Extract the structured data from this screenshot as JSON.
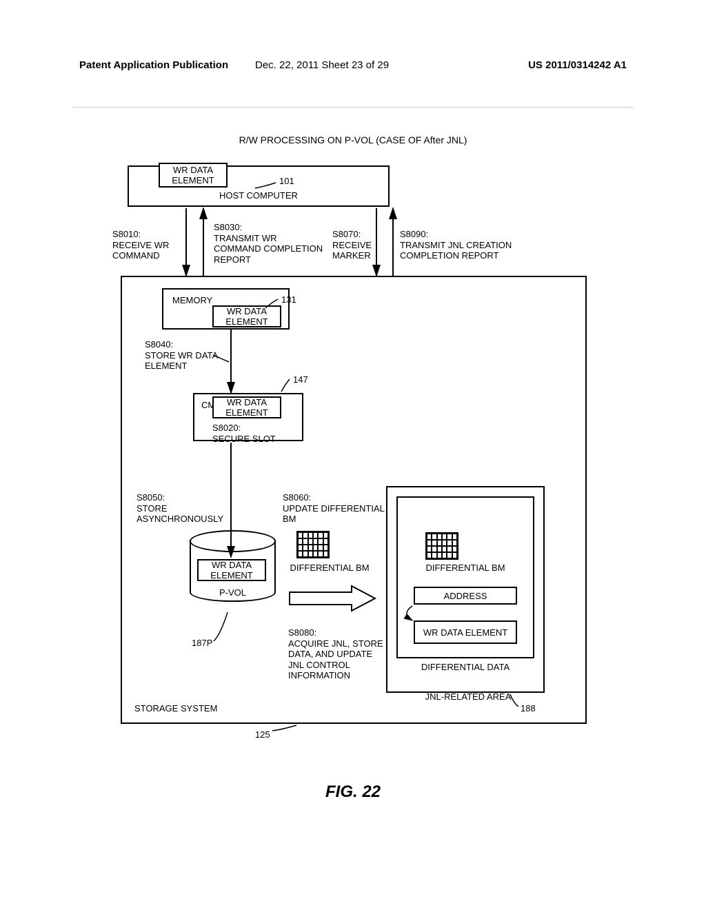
{
  "header": {
    "left": "Patent Application Publication",
    "mid": "Dec. 22, 2011  Sheet 23 of 29",
    "right": "US 2011/0314242 A1"
  },
  "title": "R/W PROCESSING ON P-VOL (CASE OF After JNL)",
  "fig": "FIG. 22",
  "host": {
    "label": "HOST COMPUTER",
    "wrdata": "WR DATA ELEMENT",
    "ref": "101"
  },
  "steps": {
    "s8010": "S8010:\nRECEIVE WR COMMAND",
    "s8030": "S8030:\nTRANSMIT WR COMMAND COMPLETION REPORT",
    "s8070": "S8070:\nRECEIVE MARKER",
    "s8090": "S8090:\nTRANSMIT JNL CREATION COMPLETION REPORT",
    "s8040": "S8040:\nSTORE WR DATA ELEMENT",
    "s8020": "S8020:\nSECURE SLOT",
    "s8050": "S8050:\nSTORE ASYNCHRONOUSLY",
    "s8060": "S8060:\nUPDATE DIFFERENTIAL BM",
    "s8080": "S8080:\nACQUIRE JNL, STORE DATA, AND UPDATE JNL CONTROL INFORMATION"
  },
  "storage": {
    "label": "STORAGE SYSTEM",
    "ref": "125"
  },
  "memory": {
    "label": "MEMORY",
    "wrdata": "WR DATA ELEMENT",
    "ref": "131"
  },
  "cm": {
    "label": "CM",
    "wrdata": "WR DATA ELEMENT",
    "ref": "147"
  },
  "pvol": {
    "wrdata": "WR DATA ELEMENT",
    "label": "P-VOL",
    "ref": "187P"
  },
  "diffbm": {
    "left": "DIFFERENTIAL BM",
    "right": "DIFFERENTIAL BM"
  },
  "jnl": {
    "address": "ADDRESS",
    "wrdata": "WR DATA ELEMENT",
    "diffdata": "DIFFERENTIAL DATA",
    "label": "JNL-RELATED AREA",
    "ref": "188"
  },
  "chart_data": {
    "type": "diagram",
    "title": "R/W PROCESSING ON P-VOL (CASE OF After JNL)",
    "figure": "FIG. 22",
    "nodes": [
      {
        "id": "host",
        "ref": 101,
        "label": "HOST COMPUTER",
        "contains": [
          "WR DATA ELEMENT"
        ]
      },
      {
        "id": "storage",
        "ref": 125,
        "label": "STORAGE SYSTEM"
      },
      {
        "id": "memory",
        "ref": 131,
        "label": "MEMORY",
        "parent": "storage",
        "contains": [
          "WR DATA ELEMENT"
        ]
      },
      {
        "id": "cm",
        "ref": 147,
        "label": "CM",
        "parent": "storage",
        "contains": [
          "WR DATA ELEMENT"
        ]
      },
      {
        "id": "pvol",
        "ref": "187P",
        "label": "P-VOL",
        "parent": "storage",
        "contains": [
          "WR DATA ELEMENT"
        ]
      },
      {
        "id": "diffbm_left",
        "label": "DIFFERENTIAL BM",
        "parent": "storage"
      },
      {
        "id": "jnl_area",
        "ref": 188,
        "label": "JNL-RELATED AREA",
        "parent": "storage"
      },
      {
        "id": "diff_data",
        "label": "DIFFERENTIAL DATA",
        "parent": "jnl_area",
        "contains": [
          "DIFFERENTIAL BM",
          "ADDRESS",
          "WR DATA ELEMENT"
        ]
      }
    ],
    "steps": [
      {
        "id": "S8010",
        "text": "RECEIVE WR COMMAND",
        "from": "host",
        "to": "storage"
      },
      {
        "id": "S8020",
        "text": "SECURE SLOT",
        "at": "cm"
      },
      {
        "id": "S8030",
        "text": "TRANSMIT WR COMMAND COMPLETION REPORT",
        "from": "storage",
        "to": "host"
      },
      {
        "id": "S8040",
        "text": "STORE WR DATA ELEMENT",
        "from": "memory",
        "to": "cm"
      },
      {
        "id": "S8050",
        "text": "STORE ASYNCHRONOUSLY",
        "from": "cm",
        "to": "pvol"
      },
      {
        "id": "S8060",
        "text": "UPDATE DIFFERENTIAL BM",
        "at": "diffbm_left"
      },
      {
        "id": "S8070",
        "text": "RECEIVE MARKER",
        "from": "host",
        "to": "storage"
      },
      {
        "id": "S8080",
        "text": "ACQUIRE JNL, STORE DATA, AND UPDATE JNL CONTROL INFORMATION",
        "from": "diffbm_left",
        "to": "jnl_area"
      },
      {
        "id": "S8090",
        "text": "TRANSMIT JNL CREATION COMPLETION REPORT",
        "from": "storage",
        "to": "host"
      }
    ]
  }
}
